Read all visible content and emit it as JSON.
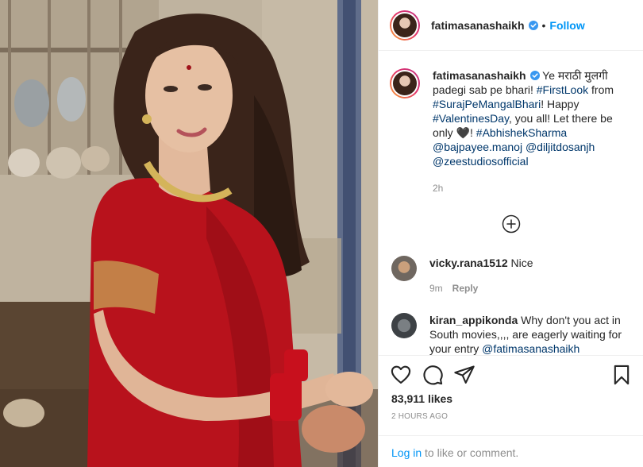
{
  "post": {
    "username": "fatimasanashaikh",
    "verified": true,
    "follow_label": "Follow",
    "separator": "•"
  },
  "caption": {
    "username": "fatimasanashaikh",
    "text_1": "Ye मराठी मुलगी padegi sab pe bhari! ",
    "tag_1": "#FirstLook",
    "text_2": " from ",
    "tag_2": "#SurajPeMangalBhari",
    "text_3": "! Happy ",
    "tag_3": "#ValentinesDay",
    "text_4": ", you all! Let there be only 🖤! ",
    "tag_4": "#AbhishekSharma",
    "tag_5": "@bajpayee.manoj",
    "tag_6": "@diljitdosanjh",
    "tag_7": "@zeestudiosofficial",
    "time": "2h"
  },
  "comments": [
    {
      "username": "vicky.rana1512",
      "text": "Nice",
      "time": "9m",
      "reply_label": "Reply"
    },
    {
      "username": "kiran_appikonda",
      "text": "Why don't you act in South movies,,,, are eagerly waiting for your entry ",
      "mention": "@fatimasanashaikh"
    }
  ],
  "actions": {
    "likes": "83,911 likes",
    "posted": "2 HOURS AGO",
    "icons": [
      "heart-icon",
      "comment-icon",
      "share-icon",
      "bookmark-icon"
    ]
  },
  "login": {
    "link": "Log in",
    "text": " to like or comment."
  },
  "colors": {
    "accent": "#0095f6",
    "hashtag": "#00376b",
    "muted": "#8e8e8e",
    "text": "#262626",
    "saree": "#b8121c"
  }
}
